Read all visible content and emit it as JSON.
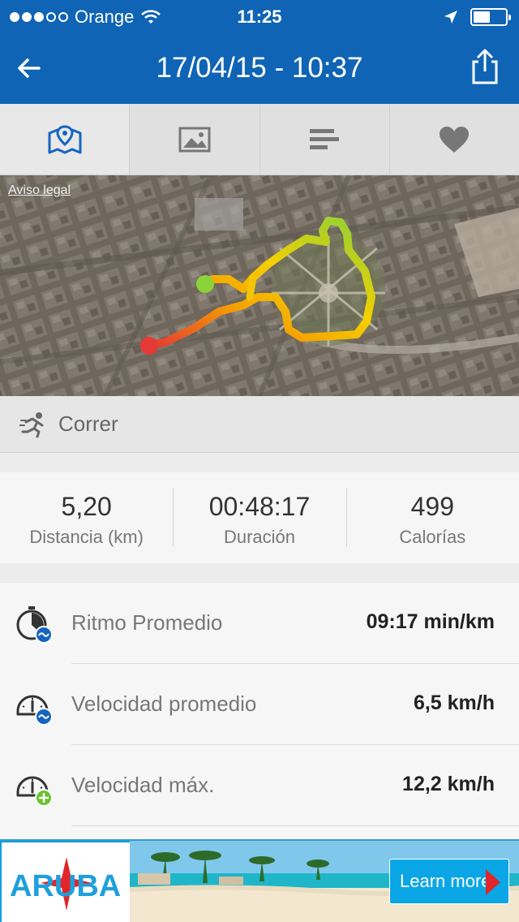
{
  "status_bar": {
    "carrier": "Orange",
    "time": "11:25"
  },
  "header": {
    "title": "17/04/15 - 10:37"
  },
  "tabs": [
    {
      "name": "map",
      "icon": "map-pin-icon",
      "active": true
    },
    {
      "name": "photo",
      "icon": "image-icon",
      "active": false
    },
    {
      "name": "stats",
      "icon": "bars-icon",
      "active": false
    },
    {
      "name": "favorite",
      "icon": "heart-icon",
      "active": false
    }
  ],
  "map": {
    "legal_link": "Aviso legal"
  },
  "activity": {
    "type_label": "Correr",
    "icon": "runner-icon"
  },
  "summary": [
    {
      "value": "5,20",
      "label": "Distancia (km)"
    },
    {
      "value": "00:48:17",
      "label": "Duración"
    },
    {
      "value": "499",
      "label": "Calorías"
    }
  ],
  "details": [
    {
      "label": "Ritmo Promedio",
      "value": "09:17 min/km",
      "icon": "pace-stopwatch-icon"
    },
    {
      "label": "Velocidad promedio",
      "value": "6,5 km/h",
      "icon": "speedometer-average-icon"
    },
    {
      "label": "Velocidad máx.",
      "value": "12,2 km/h",
      "icon": "speedometer-max-icon"
    }
  ],
  "ad": {
    "brand_text": "ARUBA",
    "cta": "Learn more"
  },
  "colors": {
    "header_bg": "#0f64b5",
    "accent_blue": "#1565c0",
    "route_red": "#e53935",
    "route_yellow": "#f5d000",
    "route_green": "#8bd138"
  }
}
